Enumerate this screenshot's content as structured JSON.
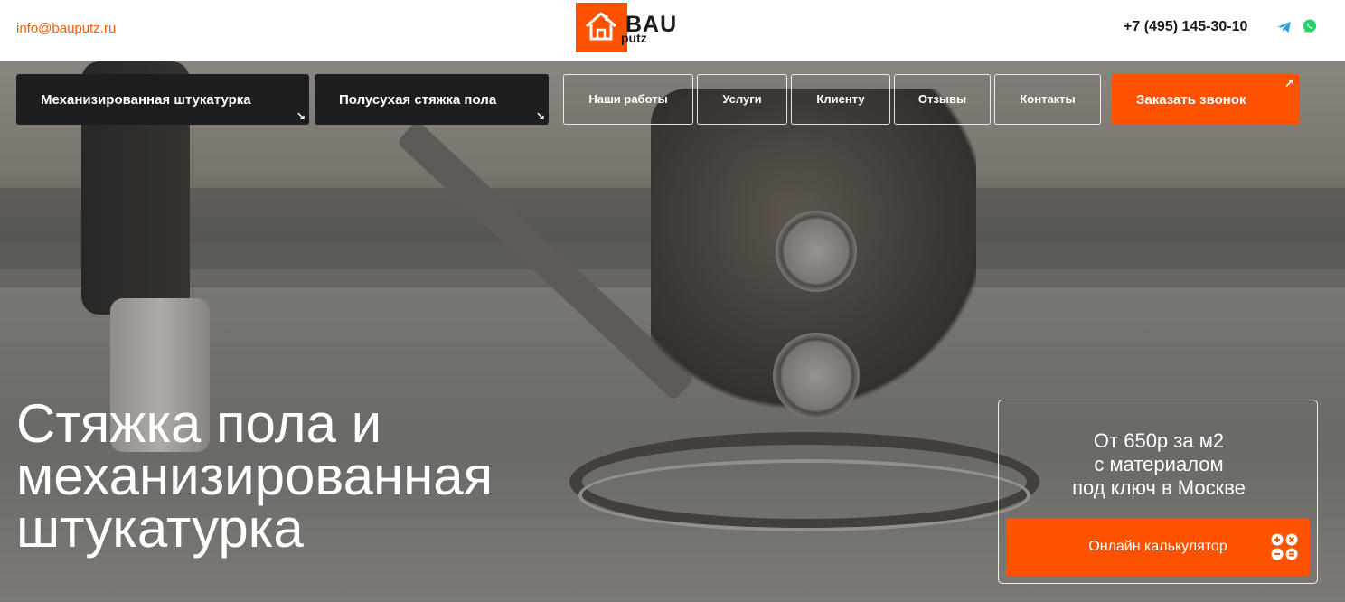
{
  "header": {
    "email": "info@bauputz.ru",
    "logo": {
      "top": "BAU",
      "bottom": "putz"
    },
    "phone": "+7 (495) 145-30-10",
    "icons": [
      "telegram-icon",
      "whatsapp-icon"
    ]
  },
  "nav": {
    "primary": [
      {
        "label": "Механизированная штукатурка",
        "arrow": "↘"
      },
      {
        "label": "Полусухая стяжка пола",
        "arrow": "↘"
      }
    ],
    "links": [
      "Наши работы",
      "Услуги",
      "Клиенту",
      "Отзывы",
      "Контакты"
    ],
    "callback": {
      "label": "Заказать звонок",
      "arrow": "↗"
    }
  },
  "hero": {
    "headline_lines": [
      "Стяжка пола и",
      "механизированная",
      "штукатурка"
    ],
    "price_lines": [
      "От 650р за м2",
      "с материалом",
      "под ключ в Москве"
    ],
    "calculator_label": "Онлайн калькулятор"
  },
  "colors": {
    "accent": "#ff5200",
    "dark": "#1e1e20",
    "text": "#1a1a1a"
  }
}
